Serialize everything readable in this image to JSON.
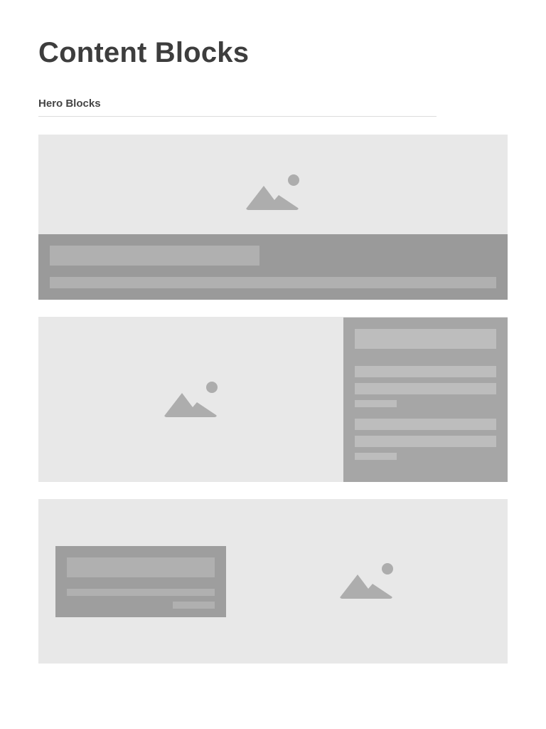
{
  "page": {
    "title": "Content Blocks"
  },
  "section": {
    "heading": "Hero Blocks"
  },
  "colors": {
    "block_background": "#e8e8e8",
    "caption_background": "#9a9a9a",
    "side_panel_background": "#a6a6a6",
    "card_background": "#9e9e9e",
    "placeholder_bar": "#b4b4b4",
    "image_icon": "#adadad",
    "title_text": "#3d3d3d"
  },
  "blocks": [
    {
      "name": "hero-block-full-width-caption",
      "image_icon": "image-placeholder-icon"
    },
    {
      "name": "hero-block-side-panel",
      "image_icon": "image-placeholder-icon"
    },
    {
      "name": "hero-block-overlay-card",
      "image_icon": "image-placeholder-icon"
    }
  ]
}
